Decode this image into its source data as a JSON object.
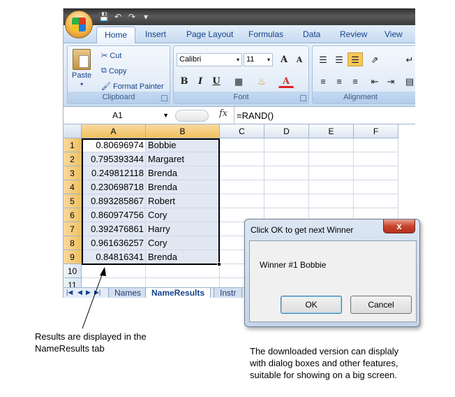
{
  "ribbon": {
    "tabs": [
      "Home",
      "Insert",
      "Page Layout",
      "Formulas",
      "Data",
      "Review",
      "View"
    ],
    "active_tab": "Home",
    "clipboard": {
      "label": "Clipboard",
      "paste": "Paste",
      "cut": "Cut",
      "copy": "Copy",
      "format_painter": "Format Painter"
    },
    "font": {
      "label": "Font",
      "name": "Calibri",
      "size": "11",
      "bold": "B",
      "italic": "I",
      "underline": "U",
      "grow": "A",
      "shrink": "A",
      "color": "A"
    },
    "alignment": {
      "label": "Alignment"
    }
  },
  "formula_bar": {
    "name_box": "A1",
    "fx": "fx",
    "formula": "=RAND()"
  },
  "grid": {
    "columns": [
      "A",
      "B",
      "C",
      "D",
      "E",
      "F"
    ],
    "rows": [
      "1",
      "2",
      "3",
      "4",
      "5",
      "6",
      "7",
      "8",
      "9",
      "10",
      "11"
    ],
    "data": [
      [
        "0.80696974",
        "Bobbie"
      ],
      [
        "0.795393344",
        "Margaret"
      ],
      [
        "0.249812118",
        "Brenda"
      ],
      [
        "0.230698718",
        "Brenda"
      ],
      [
        "0.893285867",
        "Robert"
      ],
      [
        "0.860974756",
        "Cory"
      ],
      [
        "0.392476861",
        "Harry"
      ],
      [
        "0.961636257",
        "Cory"
      ],
      [
        "0.84816341",
        "Brenda"
      ]
    ]
  },
  "sheet_tabs": [
    "Names",
    "NameResults",
    "Instr"
  ],
  "active_sheet": "NameResults",
  "dialog": {
    "title": "Click OK to get next Winner",
    "close": "x",
    "message": "Winner #1  Bobbie",
    "ok": "OK",
    "cancel": "Cancel"
  },
  "annotations": {
    "left_note": "Results are displayed in the\nNameResults tab",
    "right_note": "The downloaded version can displaly\nwith dialog boxes and other features,\nsuitable for showing on a big screen."
  }
}
